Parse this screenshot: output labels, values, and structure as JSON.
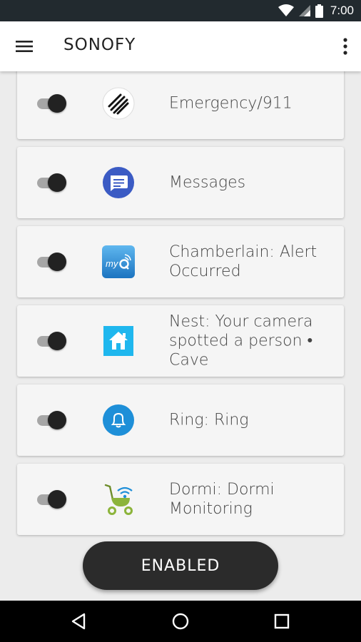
{
  "status_bar": {
    "time": "7:00",
    "icons": [
      "wifi-icon",
      "cell-signal-icon",
      "battery-icon"
    ]
  },
  "app_bar": {
    "title": "SONOFY",
    "icons": [
      "menu-icon",
      "overflow-icon"
    ]
  },
  "notifications": [
    {
      "label": "Emergency/911",
      "icon": "emergency-icon",
      "enabled": true
    },
    {
      "label": "Messages",
      "icon": "messages-icon",
      "enabled": true
    },
    {
      "label": "Chamberlain: Alert Occurred",
      "icon": "myq-icon",
      "enabled": true
    },
    {
      "label": "Nest: Your camera spotted a person • Cave",
      "icon": "nest-home-icon",
      "enabled": true
    },
    {
      "label": "Ring: Ring",
      "icon": "ring-bell-icon",
      "enabled": true
    },
    {
      "label": "Dormi: Dormi Monitoring",
      "icon": "dormi-stroller-icon",
      "enabled": true
    }
  ],
  "enabled_button": {
    "label": "ENABLED"
  },
  "nav_bar": {
    "icons": [
      "back-icon",
      "home-icon",
      "recents-icon"
    ]
  },
  "colors": {
    "status_bar": "#222a2f",
    "accent_dark": "#2b2b2b",
    "messages_blue": "#3b5bc4",
    "myq_blue": "#2a8fd6",
    "nest_cyan": "#1fb7ee",
    "ring_blue": "#1e8fd8",
    "dormi_green": "#8cb43b"
  }
}
